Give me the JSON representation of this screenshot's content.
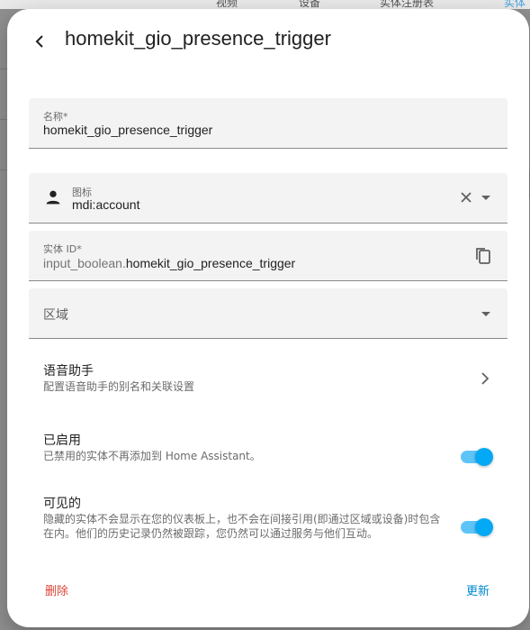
{
  "background": {
    "tabs": [
      "视频",
      "设备",
      "实体注册表",
      "实体"
    ]
  },
  "dialog": {
    "title": "homekit_gio_presence_trigger",
    "name_field": {
      "label": "名称*",
      "value": "homekit_gio_presence_trigger"
    },
    "icon_field": {
      "label": "图标",
      "value": "mdi:account",
      "icon": "account-icon"
    },
    "entity_field": {
      "label": "实体 ID*",
      "prefix": "input_boolean.",
      "value": "homekit_gio_presence_trigger"
    },
    "area_field": {
      "placeholder": "区域"
    },
    "voice": {
      "title": "语音助手",
      "subtitle": "配置语音助手的别名和关联设置"
    },
    "enabled": {
      "title": "已启用",
      "subtitle": "已禁用的实体不再添加到 Home Assistant。",
      "on": true
    },
    "visible": {
      "title": "可见的",
      "subtitle": "隐藏的实体不会显示在您的仪表板上，也不会在间接引用(即通过区域或设备)时包含在内。他们的历史记录仍然被跟踪，您仍然可以通过服务与他们互动。",
      "on": true
    },
    "delete_label": "删除",
    "update_label": "更新"
  },
  "colors": {
    "accent": "#03a9f4",
    "danger": "#db4437",
    "link": "#0288d1"
  }
}
